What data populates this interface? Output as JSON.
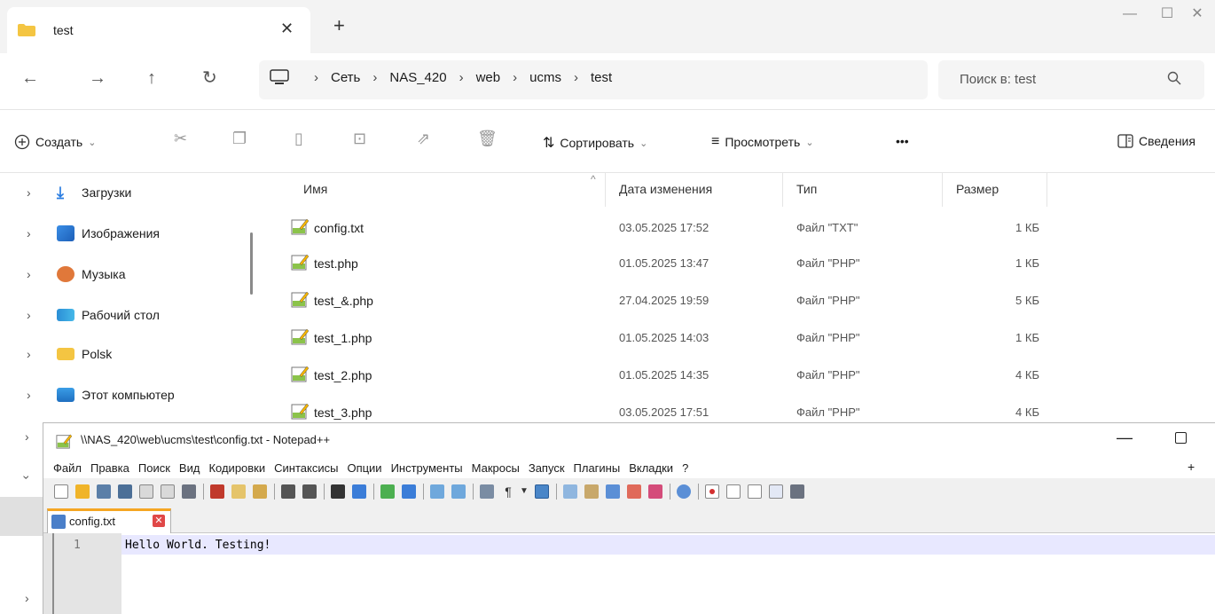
{
  "explorer": {
    "tab_title": "test",
    "tab_close": "✕",
    "tab_add": "+",
    "window_controls": {
      "minimize": "—",
      "maximize": "☐",
      "close": "✕"
    },
    "nav": {
      "back": "←",
      "forward": "→",
      "up": "↑",
      "refresh": "↻"
    },
    "breadcrumbs": [
      "Сеть",
      "NAS_420",
      "web",
      "ucms",
      "test"
    ],
    "breadcrumb_sep": "›",
    "search_placeholder": "Поиск в: test",
    "search_icon": "search-icon",
    "commands": {
      "new": "Создать",
      "sort": "Сортировать",
      "view": "Просмотреть",
      "more": "•••",
      "details": "Сведения"
    },
    "sidebar": [
      {
        "label": "Загрузки",
        "icon": "download-icon",
        "arrow": "›"
      },
      {
        "label": "Изображения",
        "icon": "pictures-icon",
        "arrow": "›"
      },
      {
        "label": "Музыка",
        "icon": "music-icon",
        "arrow": "›"
      },
      {
        "label": "Рабочий стол",
        "icon": "desktop-icon",
        "arrow": "›"
      },
      {
        "label": "Polsk",
        "icon": "folder-icon",
        "arrow": "›"
      },
      {
        "label": "Этот компьютер",
        "icon": "computer-icon",
        "arrow": "›"
      }
    ],
    "columns": {
      "name": "Имя",
      "date": "Дата изменения",
      "type": "Тип",
      "size": "Размер"
    },
    "sort_indicator": "^",
    "files": [
      {
        "name": "config.txt",
        "date": "03.05.2025 17:52",
        "type": "Файл \"TXT\"",
        "size": "1 КБ"
      },
      {
        "name": "test.php",
        "date": "01.05.2025 13:47",
        "type": "Файл \"PHP\"",
        "size": "1 КБ"
      },
      {
        "name": "test_&.php",
        "date": "27.04.2025 19:59",
        "type": "Файл \"PHP\"",
        "size": "5 КБ"
      },
      {
        "name": "test_1.php",
        "date": "01.05.2025 14:03",
        "type": "Файл \"PHP\"",
        "size": "1 КБ"
      },
      {
        "name": "test_2.php",
        "date": "01.05.2025 14:35",
        "type": "Файл \"PHP\"",
        "size": "4 КБ"
      },
      {
        "name": "test_3.php",
        "date": "03.05.2025 17:51",
        "type": "Файл \"PHP\"",
        "size": "4 КБ"
      }
    ]
  },
  "notepad": {
    "title": "\\\\NAS_420\\web\\ucms\\test\\config.txt - Notepad++",
    "menu": [
      "Файл",
      "Правка",
      "Поиск",
      "Вид",
      "Кодировки",
      "Синтаксисы",
      "Опции",
      "Инструменты",
      "Макросы",
      "Запуск",
      "Плагины",
      "Вкладки",
      "?"
    ],
    "menu_plus": "+",
    "tab_label": "config.txt",
    "tab_close": "✕",
    "line_number": "1",
    "content": "Hello World. Testing!"
  }
}
